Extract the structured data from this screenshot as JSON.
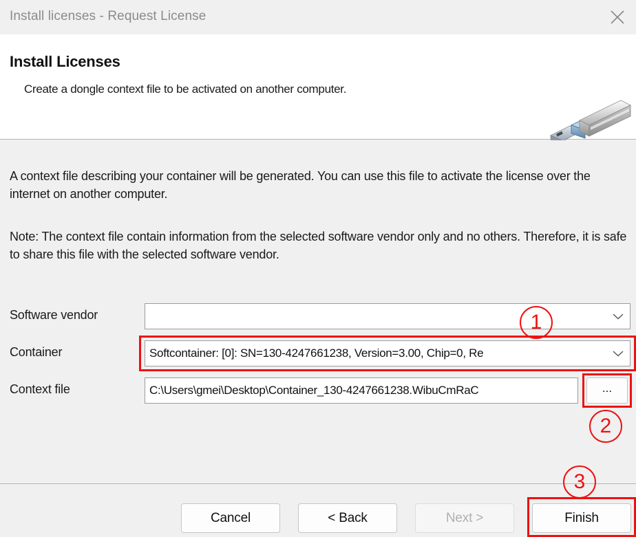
{
  "window": {
    "title": "Install licenses - Request License",
    "close_icon": "close-icon"
  },
  "header": {
    "title": "Install Licenses",
    "subtitle": "Create a dongle context file to be activated on another computer.",
    "graphic": "usb-dongle-icon"
  },
  "body": {
    "paragraph1": "A context file describing your container will be generated. You can use this file to activate the license over the internet on another computer.",
    "paragraph2": "Note: The context file contain information from the selected software vendor only and no others. Therefore, it is safe to share this file with the selected software vendor."
  },
  "form": {
    "vendor": {
      "label": "Software vendor",
      "value": "",
      "dropdown_icon": "chevron-down-icon"
    },
    "container": {
      "label": "Container",
      "value": "Softcontainer: [0]: SN=130-4247661238, Version=3.00, Chip=0, Re",
      "dropdown_icon": "chevron-down-icon"
    },
    "context_file": {
      "label": "Context file",
      "value": "C:\\Users\\gmei\\Desktop\\Container_130-4247661238.WibuCmRaC",
      "browse_label": "..."
    }
  },
  "footer": {
    "cancel_label": "Cancel",
    "back_label": "< Back",
    "next_label": "Next >",
    "finish_label": "Finish"
  },
  "annotations": {
    "marker1": "1",
    "marker2": "2",
    "marker3": "3",
    "color": "#ee1111"
  }
}
